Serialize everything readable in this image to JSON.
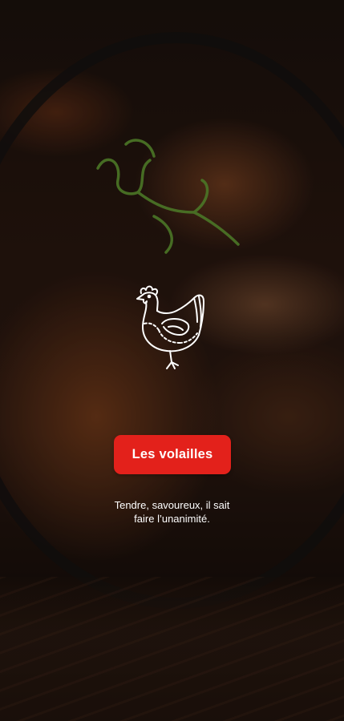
{
  "category": {
    "icon": "chicken-icon",
    "button_label": "Les volailles",
    "description_lines": [
      "Tendre, savoureux, il sait",
      "faire l’unanimité."
    ]
  },
  "colors": {
    "accent": "#e3211b",
    "text": "#ffffff"
  }
}
